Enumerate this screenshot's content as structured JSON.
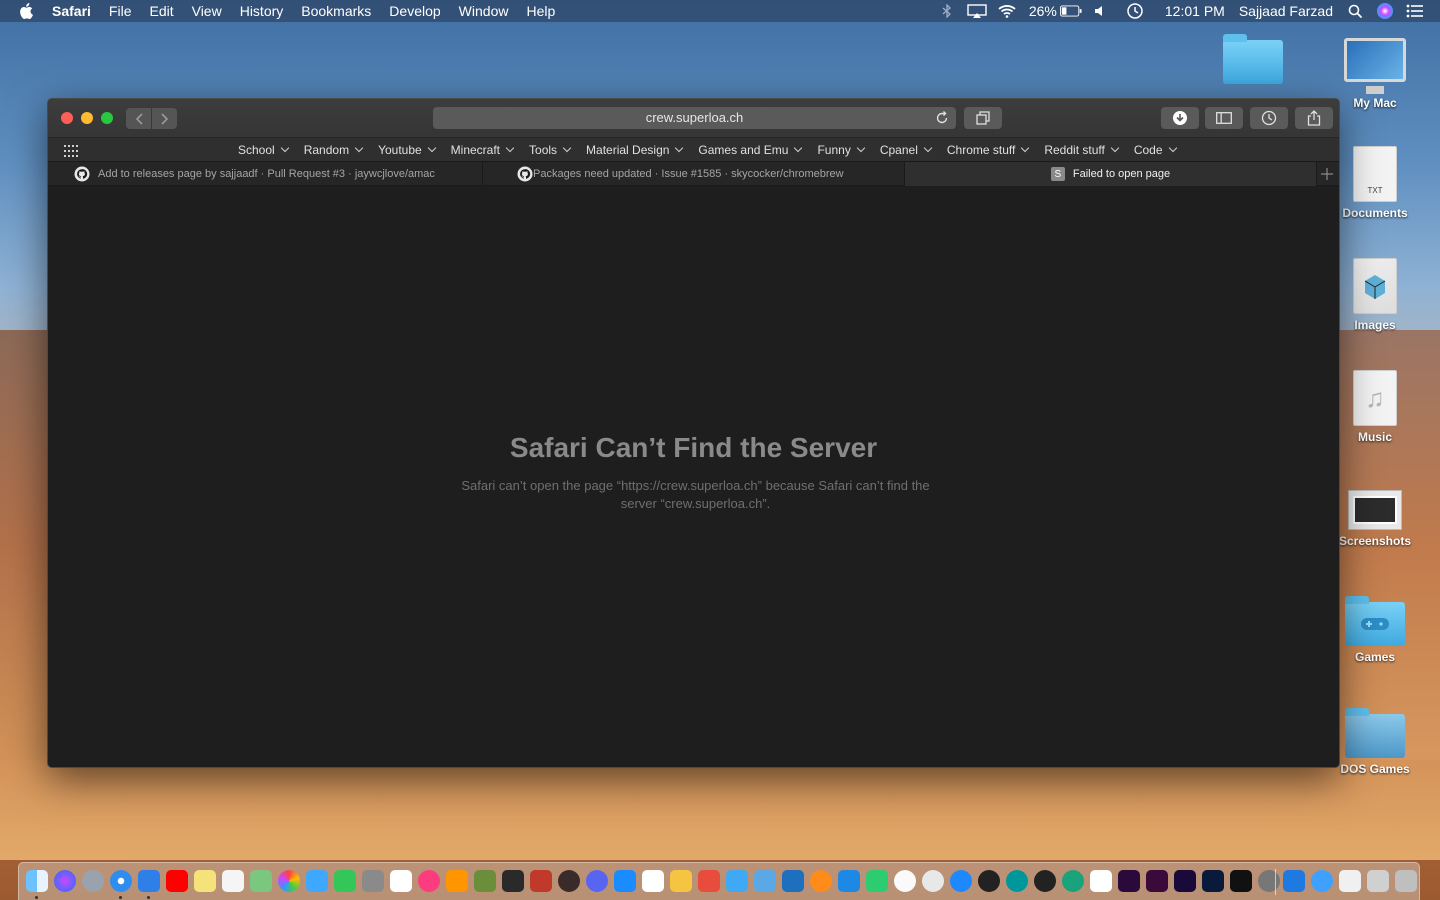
{
  "menubar": {
    "app_name": "Safari",
    "menus": [
      "File",
      "Edit",
      "View",
      "History",
      "Bookmarks",
      "Develop",
      "Window",
      "Help"
    ],
    "battery": "26%",
    "clock": "12:01 PM",
    "user": "Sajjaad Farzad"
  },
  "desktop": {
    "icons": [
      {
        "label": "My Mac",
        "icon": "imac-icon"
      },
      {
        "label": "Documents",
        "icon": "document-icon",
        "doc_tag": "TXT"
      },
      {
        "label": "Images",
        "icon": "images-icon"
      },
      {
        "label": "Music",
        "icon": "music-icon"
      },
      {
        "label": "Screenshots",
        "icon": "screenshots-icon"
      },
      {
        "label": "Games",
        "icon": "games-folder-icon"
      },
      {
        "label": "DOS Games",
        "icon": "dos-folder-icon"
      }
    ]
  },
  "browser": {
    "url": "crew.superloa.ch",
    "bookmarks": [
      "School",
      "Random",
      "Youtube",
      "Minecraft",
      "Tools",
      "Material Design",
      "Games and Emu",
      "Funny",
      "Cpanel",
      "Chrome stuff",
      "Reddit stuff",
      "Code"
    ],
    "tabs": [
      {
        "title": "Add to releases page by sajjaadf · Pull Request #3 · jaywcjlove/amac",
        "icon": "github-icon"
      },
      {
        "title": "Packages need updated · Issue #1585 · skycocker/chromebrew",
        "icon": "github-icon"
      },
      {
        "title": "Failed to open page",
        "icon": "s-favicon",
        "favicon_letter": "S",
        "active": true
      }
    ],
    "error": {
      "title": "Safari Can’t Find the Server",
      "message": "Safari can’t open the page “https://crew.superloa.ch” because Safari can’t find the server “crew.superloa.ch”."
    }
  },
  "colors": {
    "window_bg": "#1e1e1e",
    "close": "#fe5f57",
    "minimize": "#febc2e",
    "maximize": "#28c840"
  }
}
